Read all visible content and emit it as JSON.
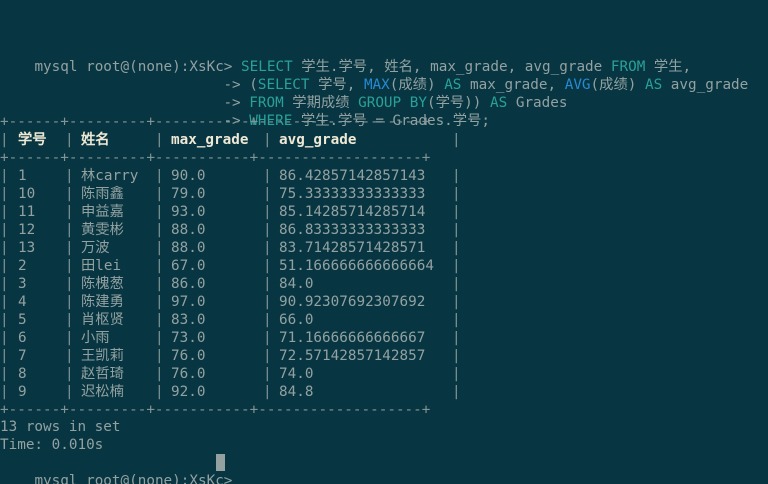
{
  "prompt": "mysql root@(none):XsKc> ",
  "cont": "-> ",
  "sql": {
    "l1": [
      {
        "t": "SELECT",
        "c": "kw"
      },
      {
        "t": " 学生.学号, 姓名, max_grade, avg_grade ",
        "c": "txt"
      },
      {
        "t": "FROM",
        "c": "kw"
      },
      {
        "t": " 学生,",
        "c": "txt"
      }
    ],
    "l2": [
      {
        "t": "(",
        "c": "txt"
      },
      {
        "t": "SELECT",
        "c": "kw"
      },
      {
        "t": " 学号, ",
        "c": "txt"
      },
      {
        "t": "MAX",
        "c": "fn"
      },
      {
        "t": "(成绩) ",
        "c": "txt"
      },
      {
        "t": "AS",
        "c": "kw"
      },
      {
        "t": " max_grade, ",
        "c": "txt"
      },
      {
        "t": "AVG",
        "c": "fn"
      },
      {
        "t": "(成绩) ",
        "c": "txt"
      },
      {
        "t": "AS",
        "c": "kw"
      },
      {
        "t": " avg_grade",
        "c": "txt"
      }
    ],
    "l3": [
      {
        "t": "FROM",
        "c": "kw"
      },
      {
        "t": " 学期成绩 ",
        "c": "txt"
      },
      {
        "t": "GROUP BY",
        "c": "kw"
      },
      {
        "t": "(学号)) ",
        "c": "txt"
      },
      {
        "t": "AS",
        "c": "kw"
      },
      {
        "t": " Grades",
        "c": "txt"
      }
    ],
    "l4": [
      {
        "t": "WHERE",
        "c": "kw"
      },
      {
        "t": " 学生.学号 = Grades.学号;",
        "c": "txt"
      }
    ]
  },
  "border": "+------+---------+-----------+-------------------+",
  "bar": "|",
  "headers": [
    "学号",
    "姓名",
    "max_grade",
    "avg_grade"
  ],
  "rows": [
    [
      "1",
      "林carry",
      "90.0",
      "86.42857142857143"
    ],
    [
      "10",
      "陈雨鑫",
      "79.0",
      "75.33333333333333"
    ],
    [
      "11",
      "申益嘉",
      "93.0",
      "85.14285714285714"
    ],
    [
      "12",
      "黄雯彬",
      "88.0",
      "86.83333333333333"
    ],
    [
      "13",
      "万波",
      "88.0",
      "83.71428571428571"
    ],
    [
      "2",
      "田lei",
      "67.0",
      "51.166666666666664"
    ],
    [
      "3",
      "陈槐葱",
      "86.0",
      "84.0"
    ],
    [
      "4",
      "陈建勇",
      "97.0",
      "90.92307692307692"
    ],
    [
      "5",
      "肖枢贤",
      "83.0",
      "66.0"
    ],
    [
      "6",
      "小雨",
      "73.0",
      "71.16666666666667"
    ],
    [
      "7",
      "王凯莉",
      "76.0",
      "72.57142857142857"
    ],
    [
      "8",
      "赵哲琦",
      "76.0",
      "74.0"
    ],
    [
      "9",
      "迟松楠",
      "92.0",
      "84.8"
    ]
  ],
  "status": {
    "rows_text": "13 rows in set",
    "time_text": "Time: 0.010s"
  },
  "colors": {
    "background": "#073642",
    "keyword": "#2aa198",
    "function": "#268bd2",
    "text": "#93a1a1"
  }
}
